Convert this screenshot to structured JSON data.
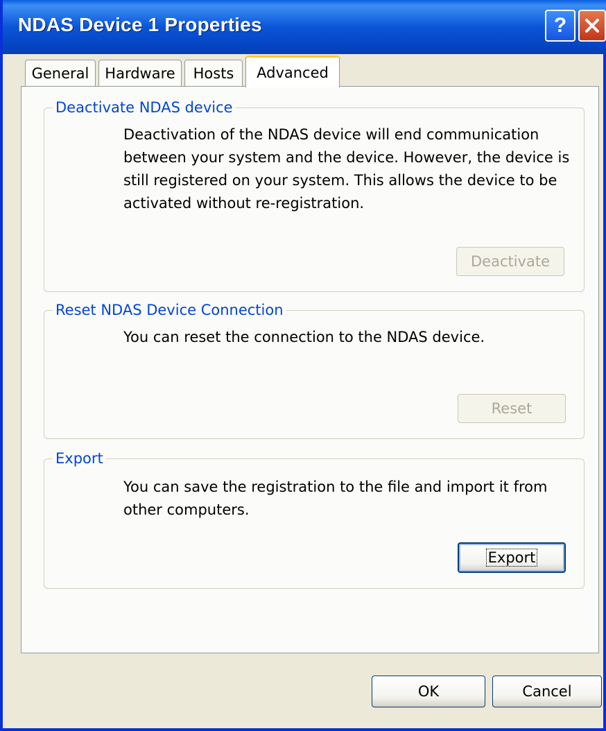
{
  "window": {
    "title": "NDAS Device 1 Properties"
  },
  "titlebar_buttons": {
    "help": "?",
    "close_icon": "close-icon"
  },
  "tabs": [
    {
      "label": "General"
    },
    {
      "label": "Hardware"
    },
    {
      "label": "Hosts"
    },
    {
      "label": "Advanced",
      "selected": true
    }
  ],
  "sections": {
    "deactivate": {
      "title": "Deactivate NDAS device",
      "description": "Deactivation of the NDAS device will end communication between your system and the device. However, the device is still registered on your system. This allows the device to be activated without re-registration.",
      "button_label": "Deactivate",
      "button_enabled": false
    },
    "reset": {
      "title": "Reset NDAS Device Connection",
      "description": "You can reset the connection to the NDAS device.",
      "button_label": "Reset",
      "button_enabled": false
    },
    "export": {
      "title": "Export",
      "description": "You can save the registration to the file and import it from other computers.",
      "button_label": "Export",
      "button_enabled": true
    }
  },
  "footer": {
    "ok_label": "OK",
    "cancel_label": "Cancel"
  },
  "colors": {
    "titlebar": "#0a55d8",
    "group_title": "#0046d5",
    "face": "#ece9d8",
    "tab_highlight": "#ffc83c"
  }
}
